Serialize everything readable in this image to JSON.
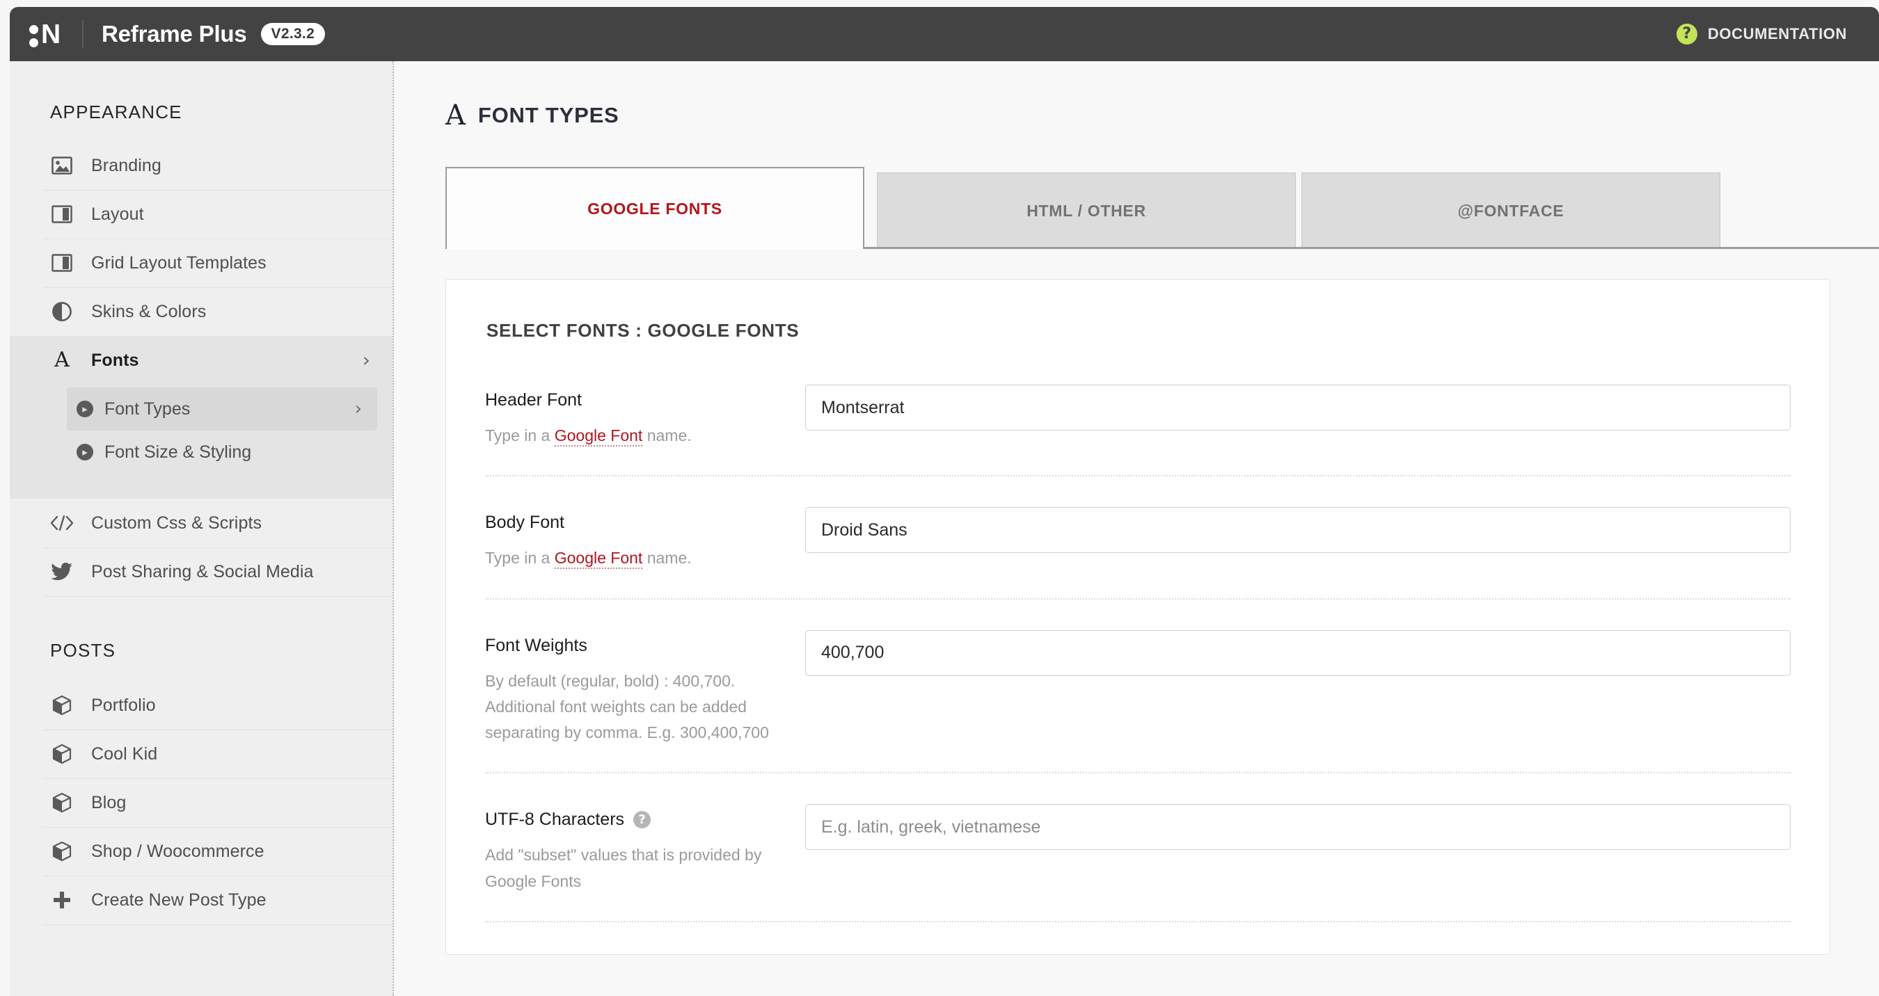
{
  "topbar": {
    "logo": "logo-mark-n",
    "brand_title": "Reframe Plus",
    "version": "V2.3.2",
    "documentation_label": "DOCUMENTATION",
    "documentation_icon": "question-circle-icon",
    "accent_green": "#c3e359",
    "bar_color": "#434343"
  },
  "sidebar": {
    "appearance_title": "APPEARANCE",
    "appearance_items": [
      {
        "label": "Branding",
        "icon": "image-icon"
      },
      {
        "label": "Layout",
        "icon": "columns-icon"
      },
      {
        "label": "Grid Layout Templates",
        "icon": "columns-icon"
      },
      {
        "label": "Skins & Colors",
        "icon": "contrast-circle-icon"
      },
      {
        "label": "Fonts",
        "icon": "serif-a-icon",
        "chevron": "›",
        "active": true
      }
    ],
    "fonts_submenu": [
      {
        "label": "Font Types",
        "bullet": "▸",
        "chevron": "›",
        "active": true
      },
      {
        "label": "Font Size & Styling",
        "bullet": "▸",
        "active": false
      }
    ],
    "appearance_items_after": [
      {
        "label": "Custom Css & Scripts",
        "icon": "code-icon"
      },
      {
        "label": "Post Sharing & Social Media",
        "icon": "twitter-bird-icon"
      }
    ],
    "posts_title": "POSTS",
    "posts_items": [
      {
        "label": "Portfolio",
        "icon": "cube-icon"
      },
      {
        "label": "Cool Kid",
        "icon": "cube-icon"
      },
      {
        "label": "Blog",
        "icon": "cube-icon"
      },
      {
        "label": "Shop / Woocommerce",
        "icon": "cube-icon"
      },
      {
        "label": "Create New Post Type",
        "icon": "plus-icon"
      }
    ]
  },
  "main": {
    "page_icon": "serif-a-icon",
    "page_title": "FONT TYPES",
    "tabs": [
      {
        "label": "GOOGLE FONTS",
        "active": true
      },
      {
        "label": "HTML / OTHER",
        "active": false
      },
      {
        "label": "@FONTFACE",
        "active": false
      }
    ],
    "active_tab_color": "#b4141c",
    "panel_title": "SELECT FONTS : GOOGLE FONTS",
    "fields": [
      {
        "label": "Header Font",
        "help_prefix": "Type in a ",
        "help_link": "Google Font",
        "help_suffix": " name.",
        "value": "Montserrat",
        "placeholder": ""
      },
      {
        "label": "Body Font",
        "help_prefix": "Type in a ",
        "help_link": "Google Font",
        "help_suffix": " name.",
        "value": "Droid Sans",
        "placeholder": ""
      },
      {
        "label": "Font Weights",
        "help_plain": "By default (regular, bold) : 400,700. Additional font weights can be added separating by comma. E.g. 300,400,700",
        "value": "400,700",
        "placeholder": ""
      },
      {
        "label": "UTF-8 Characters",
        "help_icon": "question-circle-icon",
        "help_plain": "Add \"subset\" values that is provided by Google Fonts",
        "value": "",
        "placeholder": "E.g. latin, greek, vietnamese"
      }
    ]
  }
}
